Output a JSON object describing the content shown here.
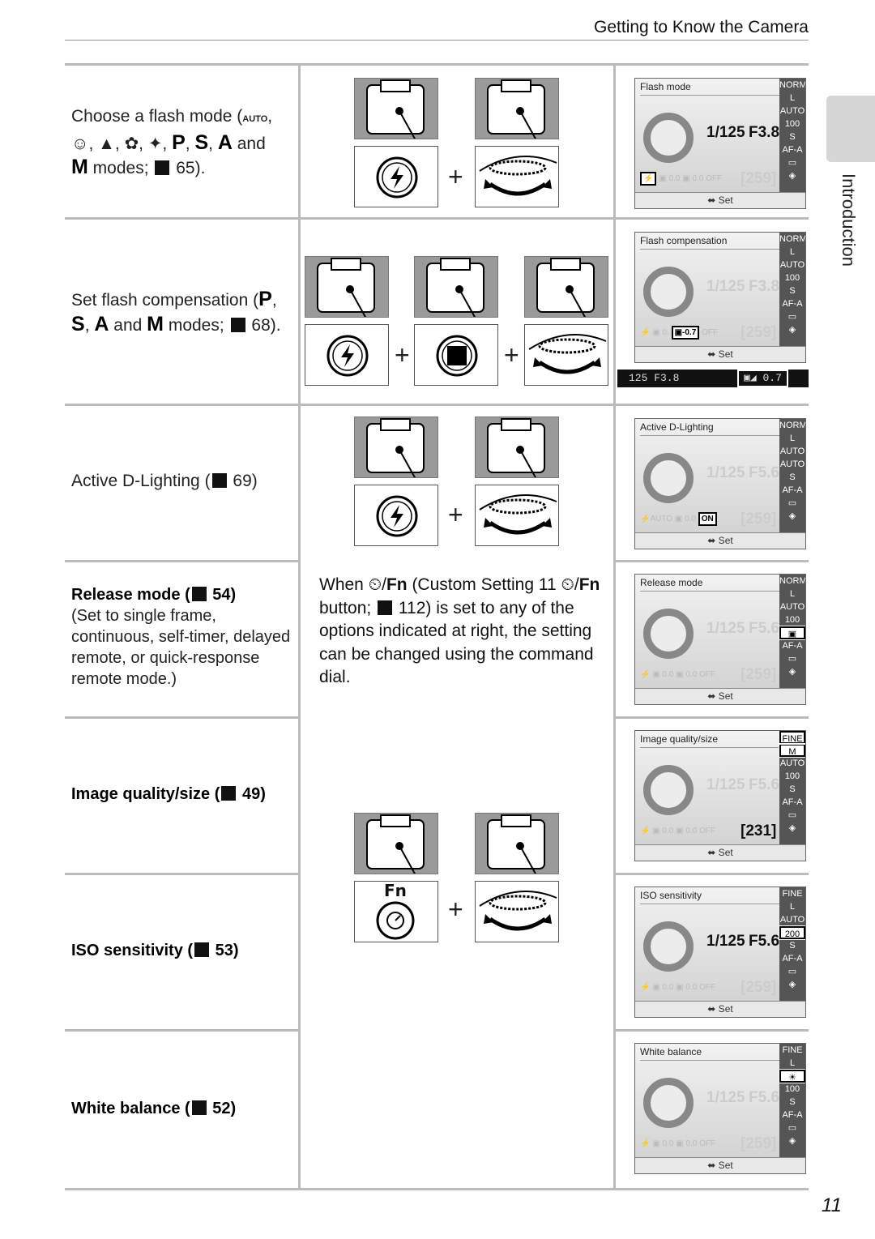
{
  "header": {
    "title": "Getting to Know the Camera"
  },
  "side_tab": {
    "label": "Introduction"
  },
  "page_number": "11",
  "rows": [
    {
      "left": {
        "text1": "Choose a flash mode (",
        "mode_auto": "AUTO",
        "text2": ",",
        "scene_modes": "portrait, landscape, child, close-up, night portrait",
        "p": "P",
        "s": "S",
        "a": "A",
        "and": "and",
        "m": "M",
        "text3": "modes;",
        "ref": "65)."
      }
    },
    {
      "left": {
        "text1": "Set flash compensation (",
        "p": "P",
        "s": "S",
        "a": "A",
        "and": "and",
        "m": "M",
        "text3": "modes;",
        "ref": "68)."
      }
    },
    {
      "left": {
        "text1": "Active D-Lighting (",
        "ref": "69)"
      }
    },
    {
      "left": {
        "title": "Release mode (",
        "ref": "54)",
        "desc": "(Set to single frame, continuous, self-timer, delayed remote, or quick-response remote mode.)"
      }
    },
    {
      "left": {
        "title": "Image quality/size (",
        "ref": "49)"
      }
    },
    {
      "left": {
        "title": "ISO sensitivity (",
        "ref": "53)"
      }
    },
    {
      "left": {
        "title": "White balance (",
        "ref": "52)"
      }
    }
  ],
  "middle_note": {
    "when": "When",
    "fn": "Fn",
    "text1": "(Custom Setting 11",
    "text2": "button;",
    "ref": "112) is set to any of the options indicated at right, the setting can be changed using the command dial."
  },
  "button_labels": {
    "fn": "Fn"
  },
  "lcds": [
    {
      "title": "Flash mode",
      "right": [
        "NORM",
        "L",
        "AUTO",
        "100",
        "S",
        "AF-A",
        "▭",
        "◈"
      ],
      "hl": [],
      "shutter": "1/125",
      "aperture": "F3.8",
      "bright": true,
      "bottom": [
        "⚡",
        "▣ 0.0",
        "▣ 0.0",
        "OFF"
      ],
      "bot_hl": 0,
      "counter": "[259]",
      "count_bright": false,
      "footer": "Set"
    },
    {
      "title": "Flash compensation",
      "right": [
        "NORM",
        "L",
        "AUTO",
        "100",
        "S",
        "AF-A",
        "▭",
        "◈"
      ],
      "hl": [],
      "shutter": "1/125",
      "aperture": "F3.8",
      "bright": false,
      "bottom": [
        "⚡",
        "▣ 0.",
        "▣-0.7",
        "OFF"
      ],
      "bot_hl": 2,
      "counter": "[259]",
      "count_bright": false,
      "footer": "Set"
    },
    {
      "title": "Active D-Lighting",
      "right": [
        "NORM",
        "L",
        "AUTO",
        "AUTO",
        "S",
        "AF-A",
        "▭",
        "◈"
      ],
      "hl": [],
      "shutter": "1/125",
      "aperture": "F5.6",
      "bright": false,
      "bottom": [
        "⚡AUTO",
        "▣ 0.0",
        "ON"
      ],
      "bot_hl": 2,
      "counter": "[259]",
      "count_bright": false,
      "footer": "Set"
    },
    {
      "title": "Release mode",
      "right": [
        "NORM",
        "L",
        "AUTO",
        "100",
        "▣",
        "AF-A",
        "▭",
        "◈"
      ],
      "hl": [
        4
      ],
      "shutter": "1/125",
      "aperture": "F5.6",
      "bright": false,
      "bottom": [
        "⚡",
        "▣ 0.0",
        "▣ 0.0",
        "OFF"
      ],
      "bot_hl": -1,
      "counter": "[259]",
      "count_bright": false,
      "footer": "Set"
    },
    {
      "title": "Image quality/size",
      "right": [
        "FINE",
        "M",
        "AUTO",
        "100",
        "S",
        "AF-A",
        "▭",
        "◈"
      ],
      "hl": [
        0,
        1
      ],
      "shutter": "1/125",
      "aperture": "F5.6",
      "bright": false,
      "bottom": [
        "⚡",
        "▣ 0.0",
        "▣ 0.0",
        "OFF"
      ],
      "bot_hl": -1,
      "counter": "[231]",
      "count_bright": true,
      "footer": "Set"
    },
    {
      "title": "ISO sensitivity",
      "right": [
        "FINE",
        "L",
        "AUTO",
        "200",
        "S",
        "AF-A",
        "▭",
        "◈"
      ],
      "hl": [
        3
      ],
      "shutter": "1/125",
      "aperture": "F5.6",
      "bright": true,
      "bottom": [
        "⚡",
        "▣ 0.0",
        "▣ 0.0",
        "OFF"
      ],
      "bot_hl": -1,
      "counter": "[259]",
      "count_bright": false,
      "footer": "Set"
    },
    {
      "title": "White balance",
      "right": [
        "FINE",
        "L",
        "☀",
        "100",
        "S",
        "AF-A",
        "▭",
        "◈"
      ],
      "hl": [
        2
      ],
      "shutter": "1/125",
      "aperture": "F5.6",
      "bright": false,
      "bottom": [
        "⚡",
        "▣ 0.0",
        "▣ 0.0",
        "OFF"
      ],
      "bot_hl": -1,
      "counter": "[259]",
      "count_bright": false,
      "footer": "Set"
    }
  ],
  "viewfinder_strip": {
    "left": "125 F3.8",
    "value": "0.7"
  }
}
